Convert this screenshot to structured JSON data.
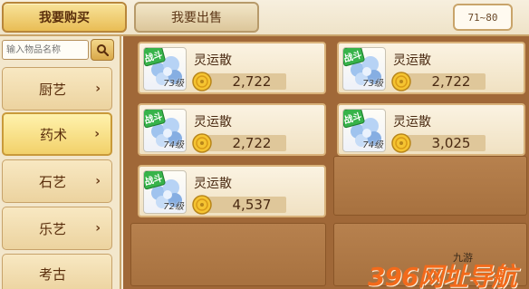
{
  "tabs": {
    "buy": "我要购买",
    "sell": "我要出售"
  },
  "level_range": "71~80",
  "search": {
    "placeholder": "输入物品名称"
  },
  "categories": [
    {
      "label": "厨艺"
    },
    {
      "label": "药术"
    },
    {
      "label": "石艺"
    },
    {
      "label": "乐艺"
    },
    {
      "label": "考古"
    }
  ],
  "selected_category": "药术",
  "items": [
    {
      "badge": "战斗",
      "level": "73级",
      "name": "灵运散",
      "price": "2,722"
    },
    {
      "badge": "战斗",
      "level": "73级",
      "name": "灵运散",
      "price": "2,722"
    },
    {
      "badge": "战斗",
      "level": "74级",
      "name": "灵运散",
      "price": "2,722"
    },
    {
      "badge": "战斗",
      "level": "74级",
      "name": "灵运散",
      "price": "3,025"
    },
    {
      "badge": "战斗",
      "level": "72级",
      "name": "灵运散",
      "price": "4,537"
    }
  ],
  "watermark": {
    "small": "九游",
    "logo": "396网址导航"
  },
  "colors": {
    "accent": "#e9bd55",
    "shelf": "#a06838",
    "card": "#f0e1c2",
    "badge": "#37b34a",
    "watermark": "#f26a1b"
  },
  "icons": {
    "search": "search-icon",
    "chevron": "chevron-right-icon",
    "coin": "gold-coin-icon",
    "item": "crystal-flower-icon"
  }
}
